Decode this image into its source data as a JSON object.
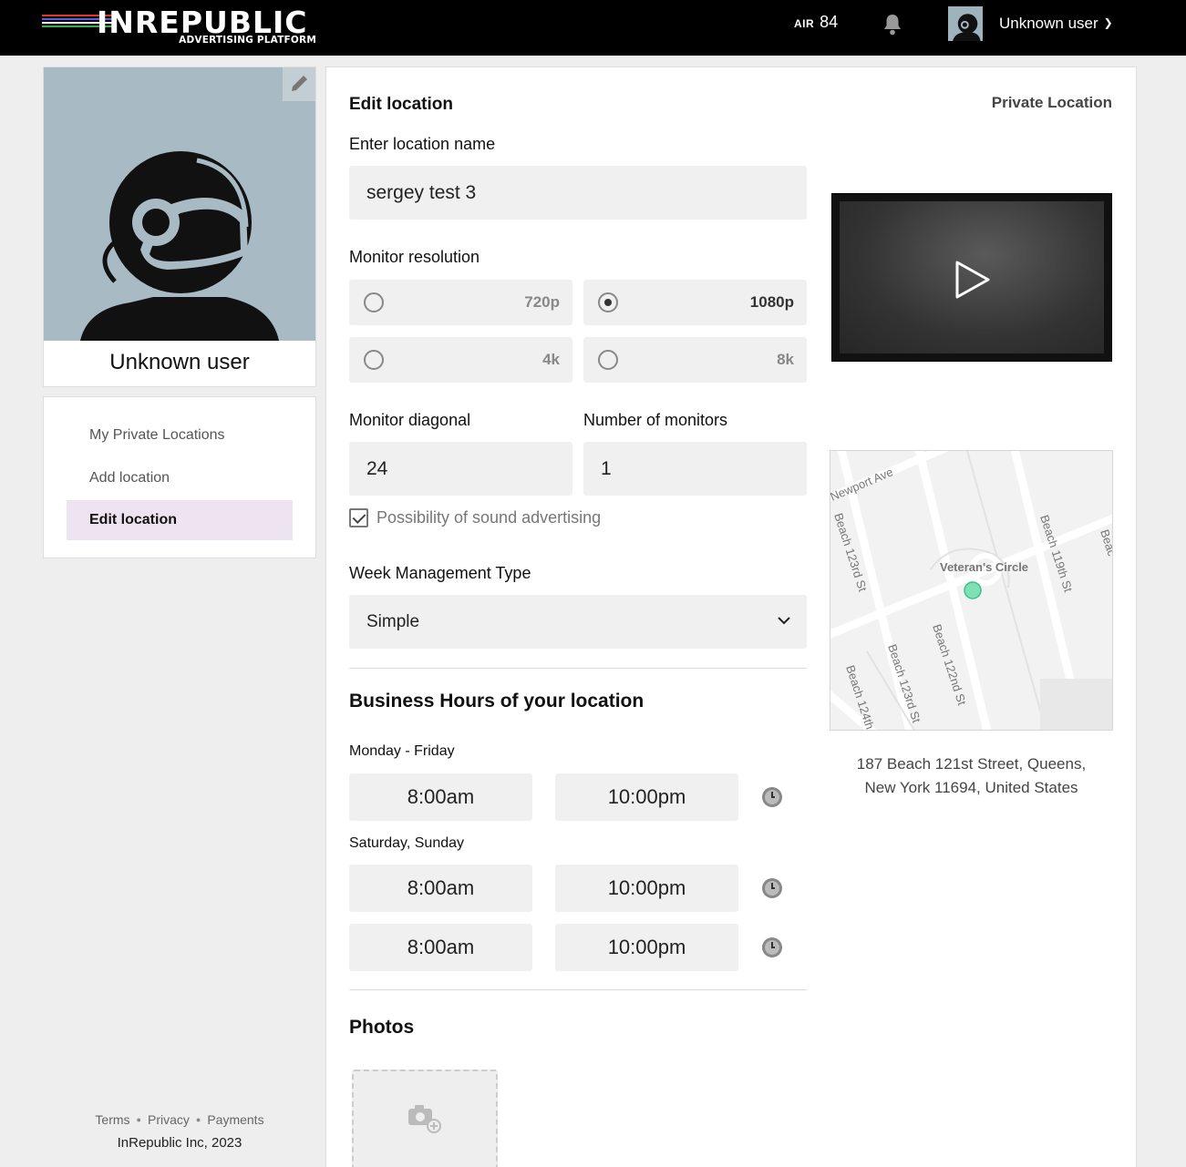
{
  "header": {
    "logo_text": "INREPUBLIC",
    "logo_subtitle": "ADVERTISING PLATFORM",
    "air_label": "AIR",
    "air_value": "84",
    "user_name": "Unknown user"
  },
  "profile": {
    "name": "Unknown user"
  },
  "sidebar": {
    "items": [
      {
        "label": "My Private Locations",
        "active": false
      },
      {
        "label": "Add location",
        "active": false
      },
      {
        "label": "Edit location",
        "active": true
      }
    ]
  },
  "footer": {
    "links": [
      "Terms",
      "Privacy",
      "Payments"
    ],
    "copyright": "InRepublic Inc, 2023"
  },
  "form": {
    "title": "Edit location",
    "tag": "Private Location",
    "name_label": "Enter location name",
    "name_value": "sergey test 3",
    "resolution_label": "Monitor resolution",
    "resolutions": [
      {
        "label": "720p",
        "selected": false
      },
      {
        "label": "1080p",
        "selected": true
      },
      {
        "label": "4k",
        "selected": false
      },
      {
        "label": "8k",
        "selected": false
      }
    ],
    "diagonal_label": "Monitor diagonal",
    "diagonal_value": "24",
    "monitors_label": "Number of monitors",
    "monitors_value": "1",
    "sound_label": "Possibility of sound advertising",
    "sound_checked": true,
    "week_type_label": "Week Management Type",
    "week_type_value": "Simple",
    "business_hours_title": "Business Hours of your location",
    "weekday_label": "Monday - Friday",
    "weekday_open": "8:00am",
    "weekday_close": "10:00pm",
    "weekend_label": "Saturday, Sunday",
    "weekend_open": "8:00am",
    "weekend_close": "10:00pm",
    "extra_open": "8:00am",
    "extra_close": "10:00pm",
    "photos_title": "Photos"
  },
  "map": {
    "streets": [
      "Newport Ave",
      "Beach 123rd St",
      "Veteran's Circle",
      "Beach 119th St",
      "Beach 122nd St",
      "Beach 123rd St",
      "Beach 124th",
      "Beac"
    ]
  },
  "address": {
    "line1": "187 Beach 121st Street, Queens,",
    "line2": "New York 11694, United States"
  },
  "colors": {
    "topbar": "#000000",
    "active_nav": "#eee3f0",
    "map_marker": "#7fe0b6",
    "field_bg": "#f0f0f0"
  }
}
